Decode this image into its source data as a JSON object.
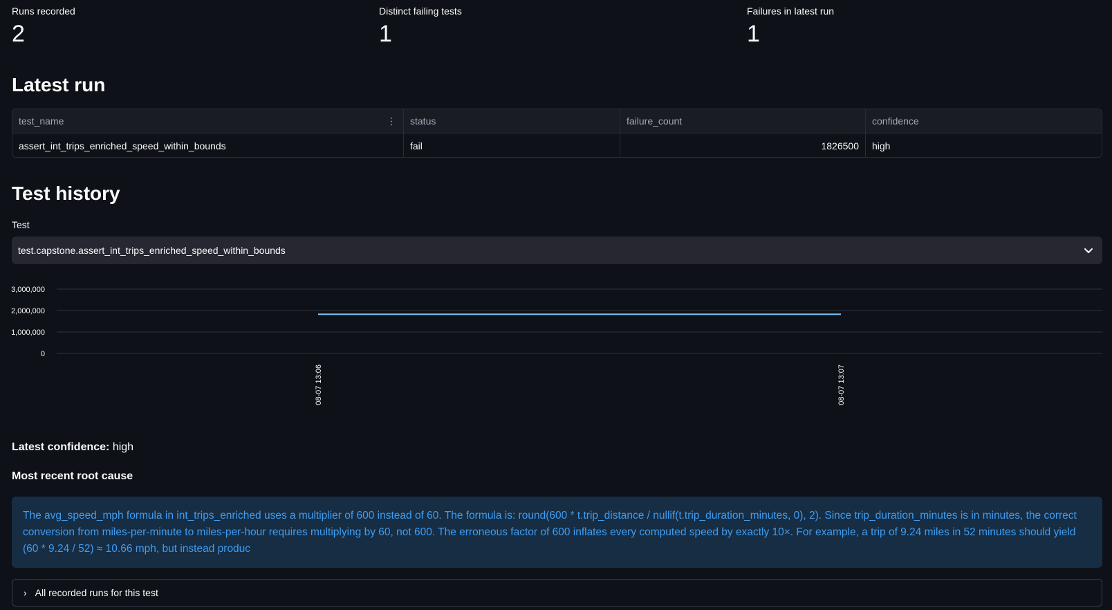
{
  "metrics": [
    {
      "label": "Runs recorded",
      "value": "2"
    },
    {
      "label": "Distinct failing tests",
      "value": "1"
    },
    {
      "label": "Failures in latest run",
      "value": "1"
    }
  ],
  "latest_run": {
    "title": "Latest run",
    "columns": [
      "test_name",
      "status",
      "failure_count",
      "confidence"
    ],
    "rows": [
      [
        "assert_int_trips_enriched_speed_within_bounds",
        "fail",
        "1826500",
        "high"
      ]
    ]
  },
  "history": {
    "title": "Test history",
    "select_label": "Test",
    "select_value": "test.capstone.assert_int_trips_enriched_speed_within_bounds"
  },
  "chart_data": {
    "type": "line",
    "x": [
      "08-07 13:06",
      "08-07 13:07"
    ],
    "series": [
      {
        "values": [
          1826500,
          1826500
        ],
        "color": "#83c9ff"
      }
    ],
    "yticks": [
      "3,000,000",
      "2,000,000",
      "1,000,000",
      "0"
    ],
    "ylim": [
      0,
      3000000
    ],
    "grid": true
  },
  "confidence": {
    "label": "Latest confidence:",
    "value": "high"
  },
  "root_cause": {
    "title": "Most recent root cause",
    "text": "The avg_speed_mph formula in int_trips_enriched uses a multiplier of 600 instead of 60. The formula is: round(600 * t.trip_distance / nullif(t.trip_duration_minutes, 0), 2). Since trip_duration_minutes is in minutes, the correct conversion from miles-per-minute to miles-per-hour requires multiplying by 60, not 600. The erroneous factor of 600 inflates every computed speed by exactly 10×. For example, a trip of 9.24 miles in 52 minutes should yield (60 * 9.24 / 52) ≈ 10.66 mph, but instead produc"
  },
  "expander": {
    "label": "All recorded runs for this test"
  }
}
